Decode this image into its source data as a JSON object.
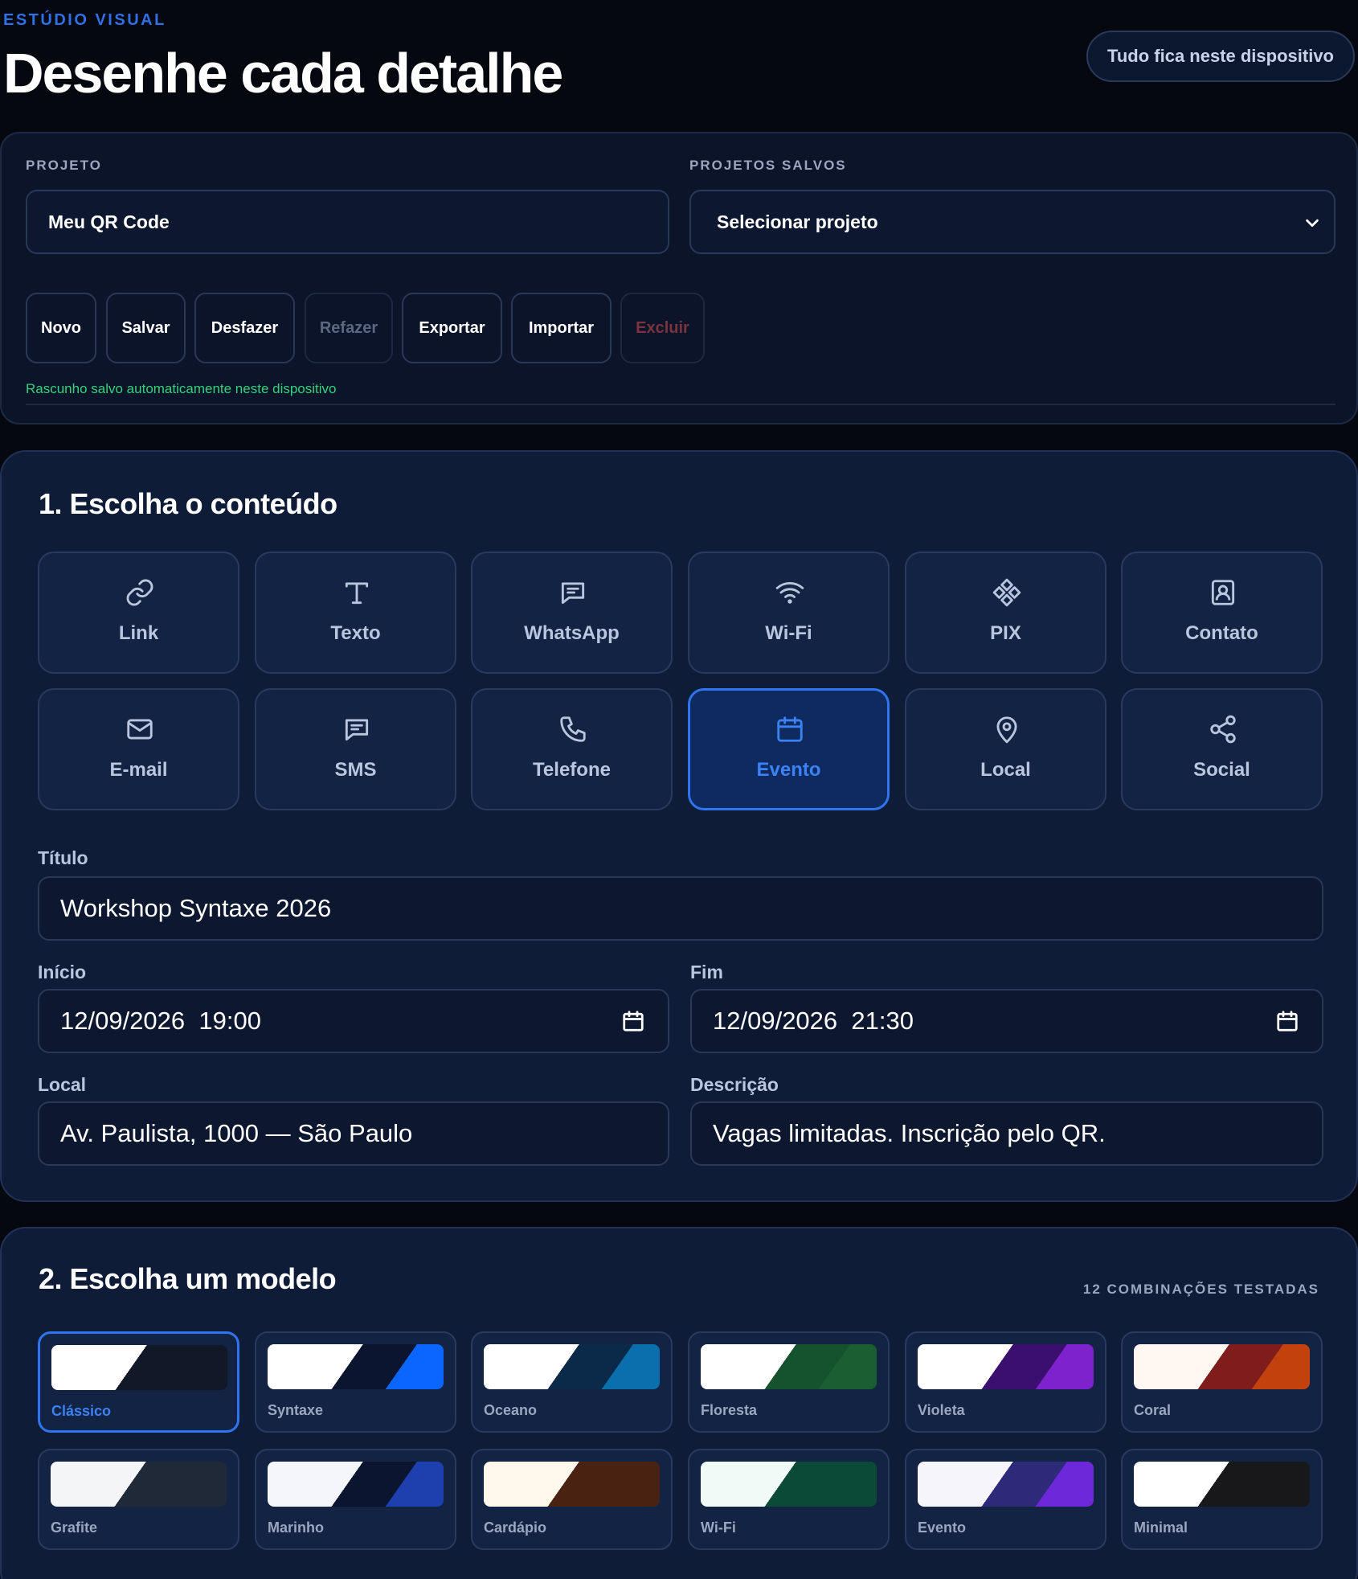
{
  "header": {
    "eyebrow": "ESTÚDIO VISUAL",
    "title": "Desenhe cada detalhe",
    "device_badge": "Tudo fica neste dispositivo"
  },
  "project": {
    "project_label": "PROJETO",
    "project_name": "Meu QR Code",
    "saved_label": "PROJETOS SALVOS",
    "saved_selected": "Selecionar projeto",
    "buttons": [
      "Novo",
      "Salvar",
      "Desfazer",
      "Refazer",
      "Exportar",
      "Importar",
      "Excluir"
    ],
    "autosave_status": "Rascunho salvo automaticamente neste dispositivo"
  },
  "content": {
    "title": "1. Escolha o conteúdo",
    "types": [
      {
        "label": "Link",
        "icon": "link-icon"
      },
      {
        "label": "Texto",
        "icon": "text-icon"
      },
      {
        "label": "WhatsApp",
        "icon": "chat-icon"
      },
      {
        "label": "Wi-Fi",
        "icon": "wifi-icon"
      },
      {
        "label": "PIX",
        "icon": "pix-icon"
      },
      {
        "label": "Contato",
        "icon": "contact-icon"
      },
      {
        "label": "E-mail",
        "icon": "mail-icon"
      },
      {
        "label": "SMS",
        "icon": "sms-icon"
      },
      {
        "label": "Telefone",
        "icon": "phone-icon"
      },
      {
        "label": "Evento",
        "icon": "calendar-icon"
      },
      {
        "label": "Local",
        "icon": "location-pin-icon"
      },
      {
        "label": "Social",
        "icon": "share-icon"
      }
    ],
    "selected_type": "Evento",
    "form": {
      "title_label": "Título",
      "title_value": "Workshop Syntaxe 2026",
      "start_label": "Início",
      "start_value": "12/09/2026  19:00",
      "end_label": "Fim",
      "end_value": "12/09/2026  21:30",
      "location_label": "Local",
      "location_value": "Av. Paulista, 1000 — São Paulo",
      "description_label": "Descrição",
      "description_value": "Vagas limitadas. Inscrição pelo QR."
    }
  },
  "models": {
    "title": "2. Escolha um modelo",
    "count_label": "12 COMBINAÇÕES TESTADAS",
    "selected": "Clássico",
    "items": [
      {
        "name": "Clássico",
        "colors": [
          "#ffffff",
          "#111827",
          "#111827"
        ]
      },
      {
        "name": "Syntaxe",
        "colors": [
          "#ffffff",
          "#0b1530",
          "#0a66ff"
        ]
      },
      {
        "name": "Oceano",
        "colors": [
          "#ffffff",
          "#0b2a4a",
          "#0b6fae"
        ]
      },
      {
        "name": "Floresta",
        "colors": [
          "#ffffff",
          "#14532d",
          "#1b5e32"
        ]
      },
      {
        "name": "Violeta",
        "colors": [
          "#ffffff",
          "#3b0f6e",
          "#7e22ce"
        ]
      },
      {
        "name": "Coral",
        "colors": [
          "#fff7f2",
          "#7f1d1d",
          "#c2410c"
        ]
      },
      {
        "name": "Grafite",
        "colors": [
          "#f4f5f7",
          "#1f2937",
          "#1f2937"
        ]
      },
      {
        "name": "Marinho",
        "colors": [
          "#f4f6fb",
          "#0b1530",
          "#1e3fae"
        ]
      },
      {
        "name": "Cardápio",
        "colors": [
          "#fff8ec",
          "#4a2211",
          "#4a2211"
        ]
      },
      {
        "name": "Wi-Fi",
        "colors": [
          "#f0fbf7",
          "#0b4a36",
          "#0b4a36"
        ]
      },
      {
        "name": "Evento",
        "colors": [
          "#f6f5fb",
          "#2e2a7a",
          "#6d28d9"
        ]
      },
      {
        "name": "Minimal",
        "colors": [
          "#ffffff",
          "#18181b",
          "#18181b"
        ]
      }
    ]
  }
}
